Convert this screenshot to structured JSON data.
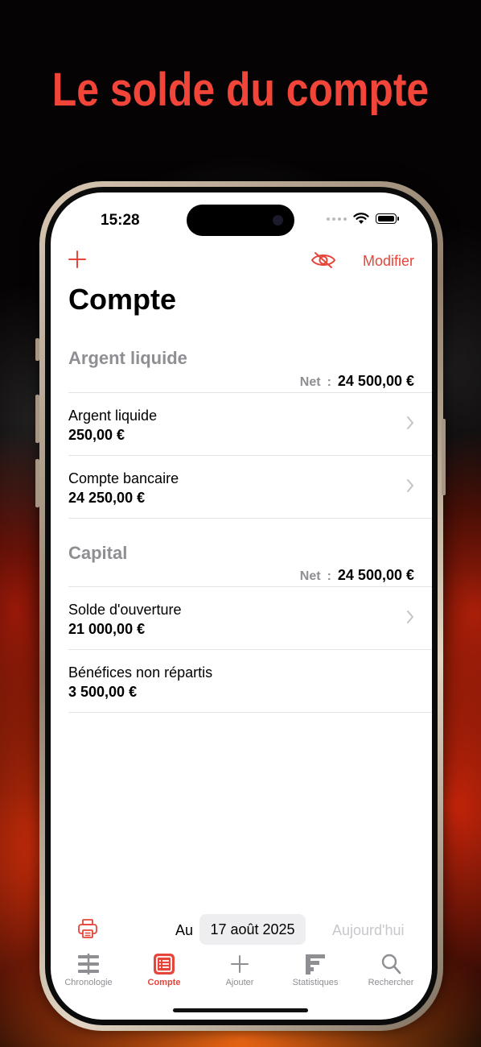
{
  "promo": {
    "headline": "Le solde du compte"
  },
  "status_bar": {
    "time": "15:28"
  },
  "nav": {
    "edit_label": "Modifier"
  },
  "page": {
    "title": "Compte"
  },
  "sections": [
    {
      "title": "Argent liquide",
      "net_label": "Net",
      "net_colon": ":",
      "net_value": "24 500,00 €",
      "rows": [
        {
          "name": "Argent liquide",
          "amount": "250,00 €",
          "chevron": true
        },
        {
          "name": "Compte bancaire",
          "amount": "24 250,00 €",
          "chevron": true
        }
      ]
    },
    {
      "title": "Capital",
      "net_label": "Net",
      "net_colon": ":",
      "net_value": "24 500,00 €",
      "rows": [
        {
          "name": "Solde d'ouverture",
          "amount": "21 000,00 €",
          "chevron": true
        },
        {
          "name": "Bénéfices non répartis",
          "amount": "3 500,00 €",
          "chevron": false
        }
      ]
    }
  ],
  "footer": {
    "au_label": "Au",
    "date": "17 août 2025",
    "today_label": "Aujourd'hui"
  },
  "tabs": [
    {
      "label": "Chronologie",
      "icon": "timeline-icon",
      "active": false
    },
    {
      "label": "Compte",
      "icon": "account-list-icon",
      "active": true
    },
    {
      "label": "Ajouter",
      "icon": "plus-icon",
      "active": false
    },
    {
      "label": "Statistiques",
      "icon": "stats-icon",
      "active": false
    },
    {
      "label": "Rechercher",
      "icon": "search-icon",
      "active": false
    }
  ],
  "colors": {
    "accent": "#e5453a",
    "headline": "#f2453a",
    "secondary": "#8e8e93"
  }
}
